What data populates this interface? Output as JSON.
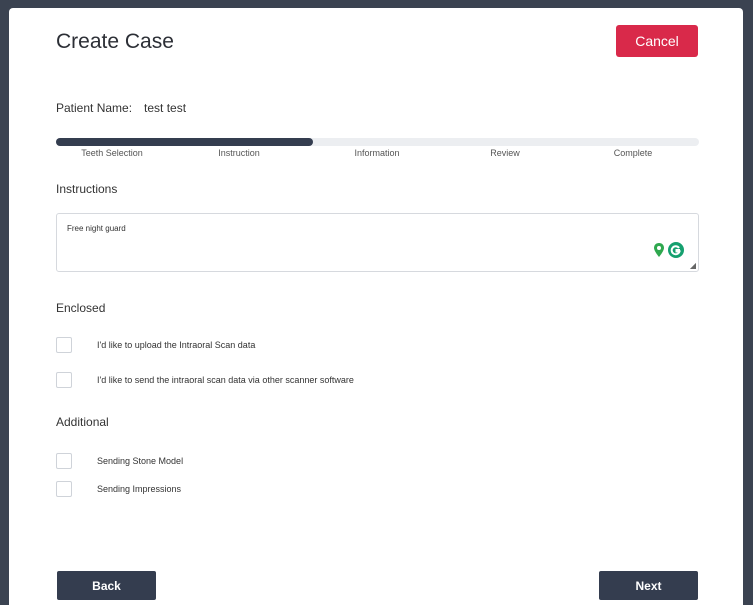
{
  "header": {
    "title": "Create Case",
    "cancel_label": "Cancel"
  },
  "patient": {
    "label": "Patient Name:",
    "value": "test test"
  },
  "progress": {
    "value": 0.4,
    "steps": [
      "Teeth Selection",
      "Instruction",
      "Information",
      "Review",
      "Complete"
    ]
  },
  "instructions": {
    "label": "Instructions",
    "value": "Free night guard"
  },
  "enclosed": {
    "label": "Enclosed",
    "options": [
      "I'd like to upload the Intraoral Scan data",
      "I'd like to send the intraoral scan data via other scanner software"
    ]
  },
  "additional": {
    "label": "Additional",
    "options": [
      "Sending Stone Model",
      "Sending Impressions"
    ]
  },
  "footer": {
    "back_label": "Back",
    "next_label": "Next"
  },
  "colors": {
    "accent": "#d9294a",
    "primary": "#343d4f",
    "backdrop": "#3b4351"
  },
  "icons": {
    "textarea_pin": "location-pin-icon",
    "textarea_grammarly": "grammarly-icon",
    "resize": "resize-handle-icon"
  }
}
